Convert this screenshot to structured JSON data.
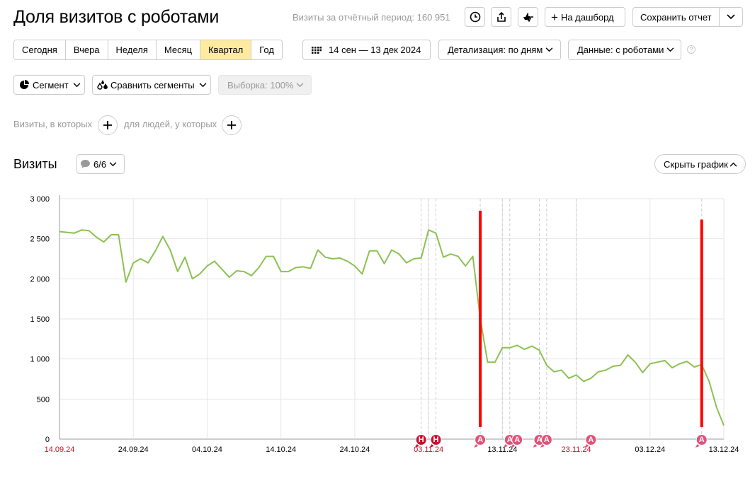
{
  "header": {
    "title": "Доля визитов с роботами",
    "visits_total": "Визиты за отчётный период: 160 951",
    "to_dashboard_label": "На дашборд",
    "save_report_label": "Сохранить отчет"
  },
  "periods": [
    {
      "label": "Сегодня",
      "active": false
    },
    {
      "label": "Вчера",
      "active": false
    },
    {
      "label": "Неделя",
      "active": false
    },
    {
      "label": "Месяц",
      "active": false
    },
    {
      "label": "Квартал",
      "active": true
    },
    {
      "label": "Год",
      "active": false
    }
  ],
  "controls": {
    "date_range": "14 сен — 13 дек 2024",
    "detail": "Детализация: по дням",
    "data": "Данные: с роботами",
    "help": "?",
    "segment": "Сегмент",
    "compare": "Сравнить сегменты",
    "sample": "Выборка: 100%"
  },
  "conditions": {
    "visits_where": "Визиты, в которых",
    "people_where": "для людей, у которых"
  },
  "section": {
    "title": "Визиты",
    "annotations_count": "6/6",
    "hide_chart": "Скрыть график"
  },
  "colors": {
    "accent_yellow": "#ffeba0",
    "line": "#8cc152",
    "highlight_red": "#ff0000",
    "holiday_marker": "#c8102e",
    "annotation_marker": "#e0527a",
    "weekend_date": "#c8102e"
  },
  "chart_data": {
    "type": "line",
    "ylim": [
      0,
      3000
    ],
    "yticks": [
      "0",
      "500",
      "1 000",
      "1 500",
      "2 000",
      "2 500",
      "3 000"
    ],
    "xtick_labels": [
      {
        "label": "14.09.24",
        "day": 0,
        "weekend": true
      },
      {
        "label": "24.09.24",
        "day": 10,
        "weekend": false
      },
      {
        "label": "04.10.24",
        "day": 20,
        "weekend": false
      },
      {
        "label": "14.10.24",
        "day": 30,
        "weekend": false
      },
      {
        "label": "24.10.24",
        "day": 40,
        "weekend": false
      },
      {
        "label": "03.11.24",
        "day": 50,
        "weekend": true
      },
      {
        "label": "13.11.24",
        "day": 60,
        "weekend": false
      },
      {
        "label": "23.11.24",
        "day": 70,
        "weekend": true
      },
      {
        "label": "03.12.24",
        "day": 80,
        "weekend": false
      },
      {
        "label": "13.12.24",
        "day": 90,
        "weekend": false
      }
    ],
    "series": [
      {
        "values": [
          2590,
          2580,
          2570,
          2610,
          2600,
          2520,
          2460,
          2550,
          2550,
          1960,
          2200,
          2250,
          2200,
          2350,
          2530,
          2360,
          2090,
          2270,
          2000,
          2060,
          2160,
          2220,
          2120,
          2020,
          2100,
          2090,
          2040,
          2140,
          2280,
          2280,
          2090,
          2090,
          2140,
          2150,
          2130,
          2360,
          2270,
          2250,
          2260,
          2220,
          2160,
          2060,
          2350,
          2350,
          2190,
          2360,
          2310,
          2200,
          2250,
          2260,
          2610,
          2570,
          2270,
          2310,
          2280,
          2160,
          2280,
          1500,
          960,
          960,
          1140,
          1140,
          1170,
          1120,
          1160,
          1110,
          920,
          840,
          860,
          760,
          800,
          720,
          760,
          840,
          860,
          910,
          920,
          1050,
          960,
          830,
          940,
          960,
          980,
          890,
          940,
          970,
          900,
          930,
          720,
          400,
          170
        ]
      }
    ],
    "holiday_markers": [
      {
        "day": 49,
        "letter": "Н"
      },
      {
        "day": 51,
        "letter": "Н"
      }
    ],
    "annotation_markers": [
      {
        "day": 57,
        "letter": "А"
      },
      {
        "day": 61,
        "letter": "А"
      },
      {
        "day": 62,
        "letter": "А"
      },
      {
        "day": 65,
        "letter": "А"
      },
      {
        "day": 66,
        "letter": "А"
      },
      {
        "day": 72,
        "letter": "А"
      },
      {
        "day": 87,
        "letter": "А"
      }
    ],
    "dashed_lines": [
      49,
      50,
      51,
      57,
      60,
      61,
      65,
      66,
      70,
      87
    ],
    "red_bars": [
      {
        "day": 57,
        "top": 2850
      },
      {
        "day": 87,
        "top": 2740
      }
    ]
  }
}
